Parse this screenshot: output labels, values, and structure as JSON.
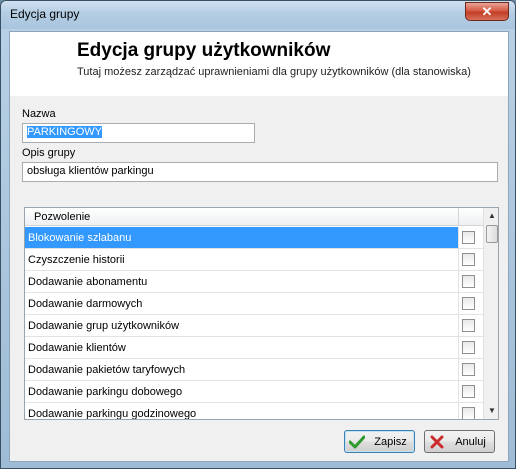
{
  "window": {
    "title": "Edycja grupy",
    "close_label": "✕"
  },
  "header": {
    "title": "Edycja grupy użytkowników",
    "subtitle": "Tutaj możesz zarządzać uprawnieniami dla grupy użytkowników (dla stanowiska)"
  },
  "form": {
    "name_label": "Nazwa",
    "name_value": "PARKINGOWY",
    "description_label": "Opis grupy",
    "description_value": "obsługa klientów parkingu"
  },
  "permissions": {
    "column_header": "Pozwolenie",
    "items": [
      {
        "label": "Blokowanie szlabanu",
        "selected": true,
        "checked": false
      },
      {
        "label": "Czyszczenie historii",
        "selected": false,
        "checked": false
      },
      {
        "label": "Dodawanie abonamentu",
        "selected": false,
        "checked": false
      },
      {
        "label": "Dodawanie darmowych",
        "selected": false,
        "checked": false
      },
      {
        "label": "Dodawanie grup użytkowników",
        "selected": false,
        "checked": false
      },
      {
        "label": "Dodawanie klientów",
        "selected": false,
        "checked": false
      },
      {
        "label": "Dodawanie pakietów taryfowych",
        "selected": false,
        "checked": false
      },
      {
        "label": "Dodawanie parkingu dobowego",
        "selected": false,
        "checked": false
      },
      {
        "label": "Dodawanie parkingu godzinowego",
        "selected": false,
        "checked": false
      }
    ]
  },
  "buttons": {
    "save_label": "Zapisz",
    "cancel_label": "Anuluj"
  },
  "icons": {
    "save": "check-icon",
    "cancel": "x-icon"
  },
  "colors": {
    "selection": "#3399ff",
    "save_icon": "#2f9a2f",
    "cancel_icon": "#cc2b2b"
  }
}
